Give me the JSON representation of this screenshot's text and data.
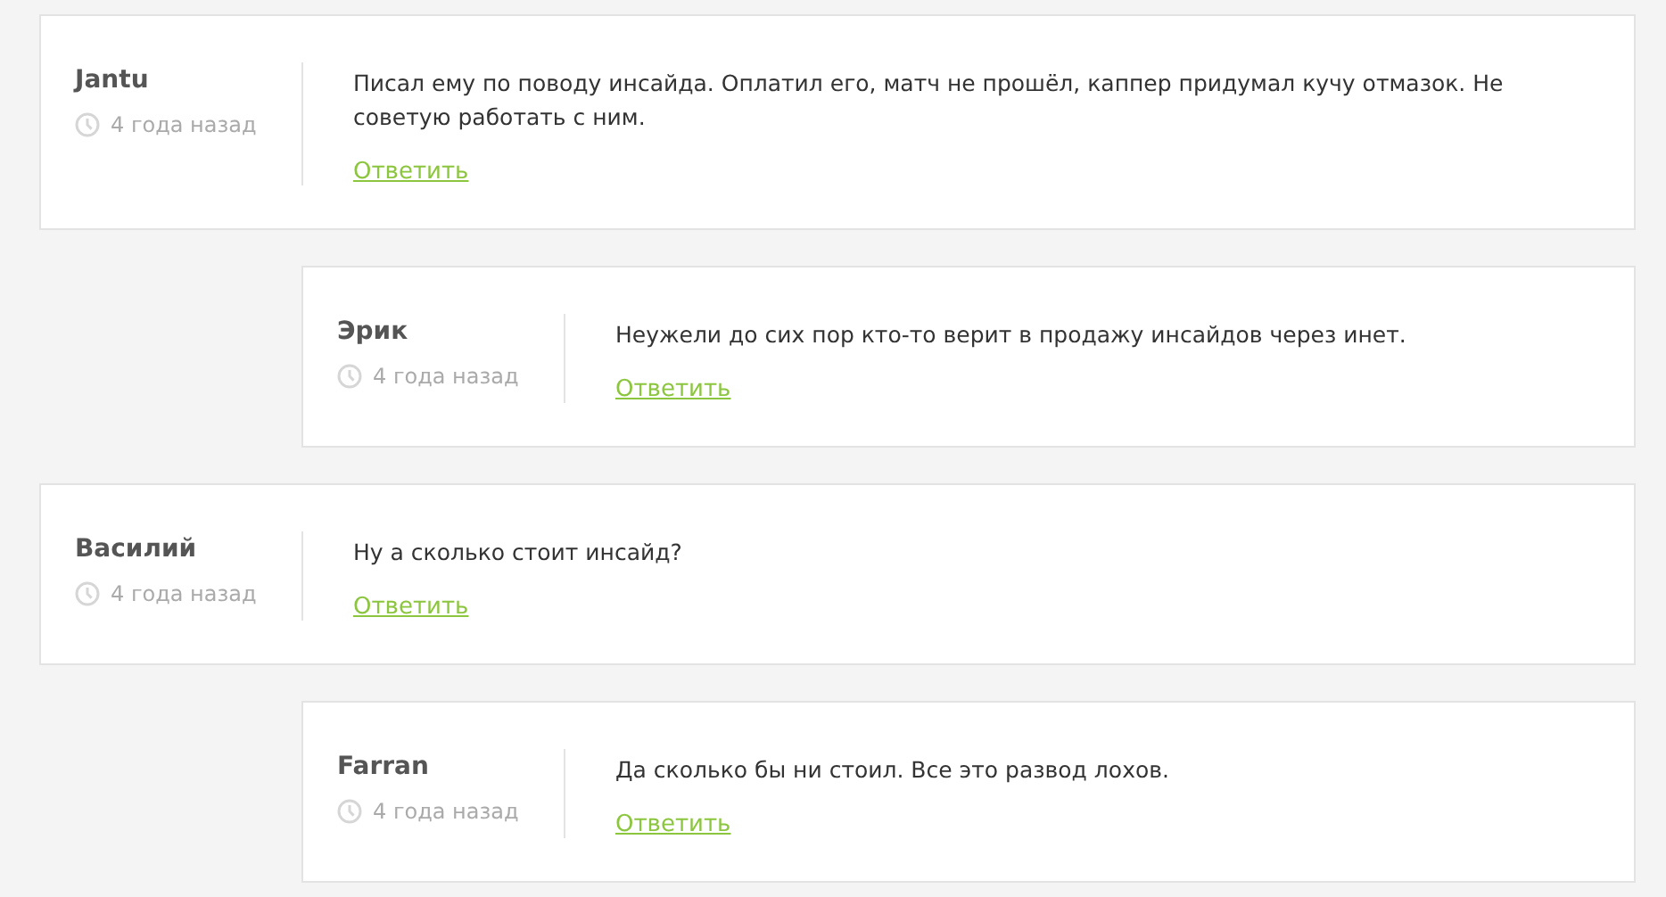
{
  "comments": [
    {
      "author": "Jantu",
      "time": "4 года назад",
      "text": "Писал ему по поводу инсайда. Оплатил его, матч не прошёл, каппер придумал кучу отмазок. Не советую работать с ним.",
      "reply_link": "Ответить",
      "children": [
        {
          "author": "Эрик",
          "time": "4 года назад",
          "text": "Неужели до сих пор кто-то верит в продажу инсайдов через инет.",
          "reply_link": "Ответить"
        }
      ]
    },
    {
      "author": "Василий",
      "time": "4 года назад",
      "text": "Ну а сколько стоит инсайд?",
      "reply_link": "Ответить",
      "children": [
        {
          "author": "Farran",
          "time": "4 года назад",
          "text": "Да сколько бы ни стоил. Все это развод лохов.",
          "reply_link": "Ответить"
        }
      ]
    }
  ]
}
